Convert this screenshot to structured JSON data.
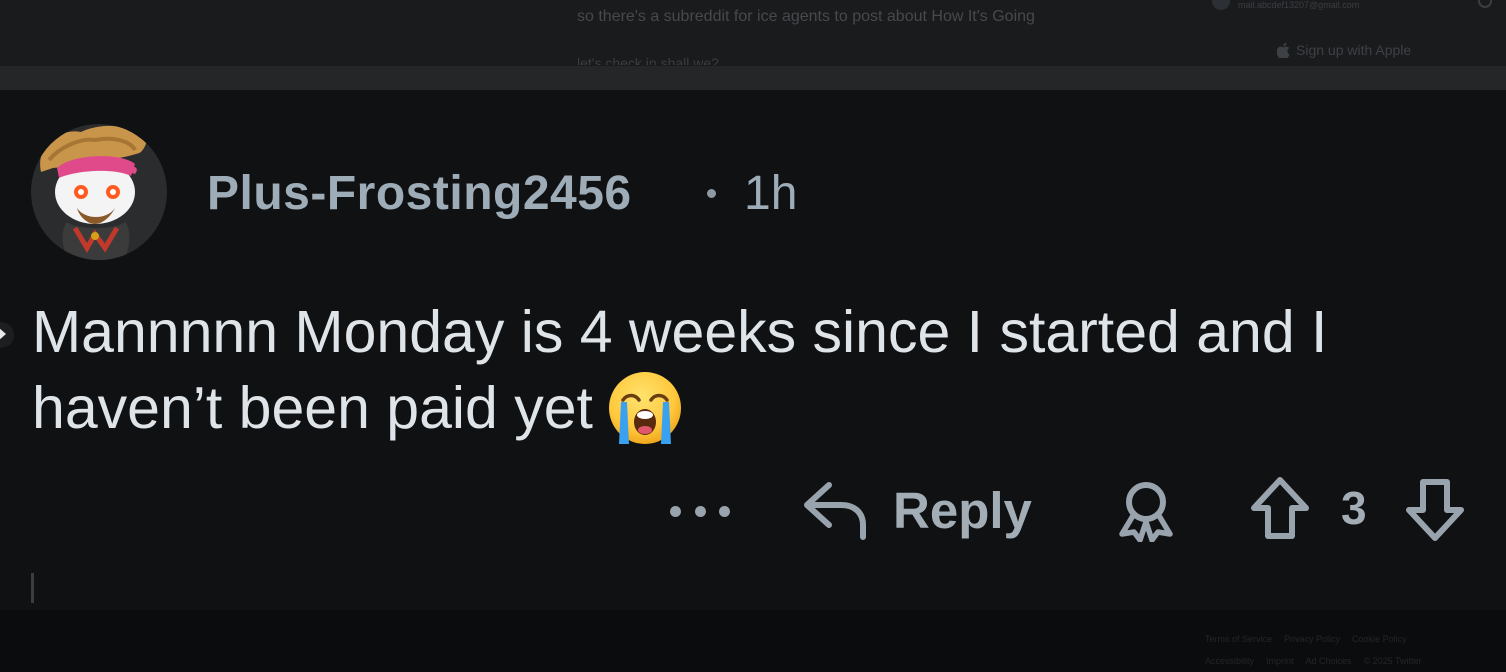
{
  "background_post": {
    "text": "so there's a subreddit for ice agents to post about How It's Going",
    "text2": "let's check in shall we?",
    "email": "mail.abcdef13207@gmail.com",
    "apple_signup": "Sign up with Apple"
  },
  "comment": {
    "username": "Plus-Frosting2456",
    "separator": "•",
    "time": "1h",
    "body": "Mannnnn Monday is 4 weeks since I started and I haven’t been paid yet",
    "emoji": "loudly-crying-face",
    "vote_count": "3"
  },
  "actions": {
    "more": "more-options",
    "reply_label": "Reply",
    "award": "award-icon",
    "upvote": "upvote-icon",
    "downvote": "downvote-icon"
  },
  "footer": {
    "row1": [
      "Terms of Service",
      "Privacy Policy",
      "Cookie Policy"
    ],
    "row2": [
      "Accessibility",
      "Imprint",
      "Ad Choices",
      "© 2025 Twitter"
    ]
  },
  "colors": {
    "background": "#0f1113",
    "username": "#9eacb7",
    "body_text": "#dfe4e8",
    "action_icons": "#98a3ad"
  }
}
